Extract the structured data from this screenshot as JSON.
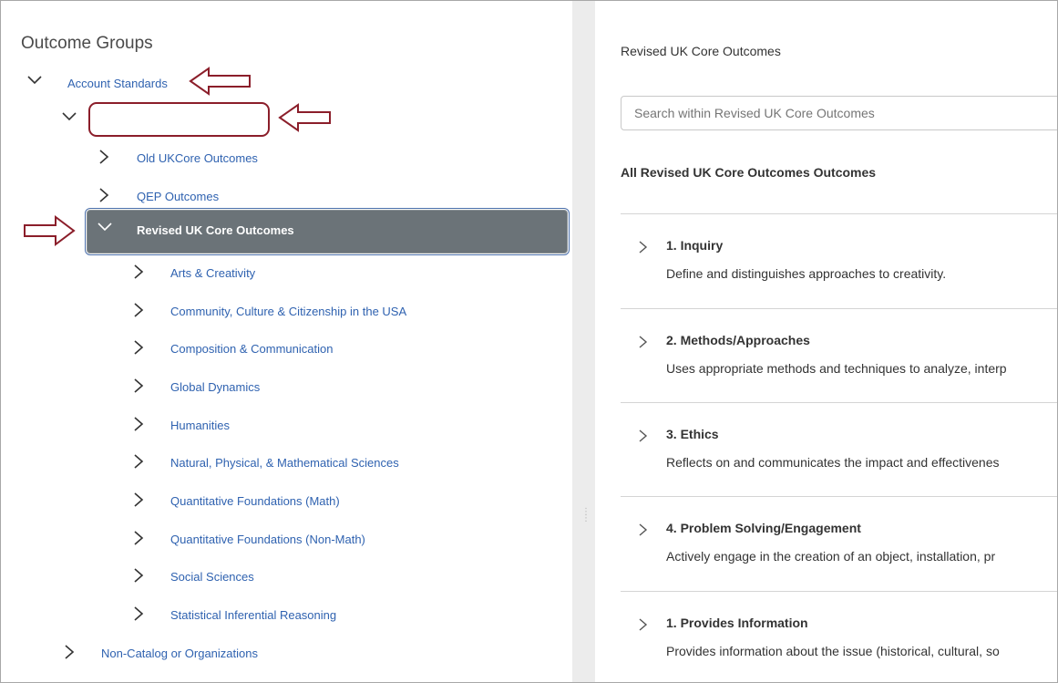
{
  "left_panel": {
    "title": "Outcome Groups",
    "tree": {
      "account_standards": "Account Standards",
      "old_ukcore": "Old UKCore Outcomes",
      "qep": "QEP Outcomes",
      "revised": "Revised UK Core Outcomes",
      "children": [
        "Arts & Creativity",
        "Community, Culture & Citizenship in the USA",
        "Composition & Communication",
        "Global Dynamics",
        "Humanities",
        "Natural, Physical, & Mathematical Sciences",
        "Quantitative Foundations (Math)",
        "Quantitative Foundations (Non-Math)",
        "Social Sciences",
        "Statistical Inferential Reasoning"
      ],
      "non_catalog": "Non-Catalog or Organizations"
    }
  },
  "right_panel": {
    "title": "Revised UK Core Outcomes",
    "search_placeholder": "Search within Revised UK Core Outcomes",
    "heading": "All Revised UK Core Outcomes Outcomes",
    "outcomes": [
      {
        "title": "1. Inquiry",
        "desc": "Define and distinguishes approaches to creativity."
      },
      {
        "title": "2. Methods/Approaches",
        "desc": "Uses appropriate methods and techniques to analyze, interp"
      },
      {
        "title": "3. Ethics",
        "desc": "Reflects on and communicates the impact and effectivenes"
      },
      {
        "title": "4. Problem Solving/Engagement",
        "desc": "Actively engage in the creation of an object, installation, pr"
      },
      {
        "title": "1. Provides Information",
        "desc": "Provides information about the issue (historical, cultural, so"
      }
    ]
  },
  "colors": {
    "link": "#2f62b0",
    "selected_bg": "#6b7378",
    "annotation": "#8b1e2a"
  },
  "icons": [
    "chevron-down-icon",
    "chevron-right-icon",
    "annotation-arrow-left-icon",
    "annotation-arrow-right-icon",
    "drag-handle-icon"
  ]
}
